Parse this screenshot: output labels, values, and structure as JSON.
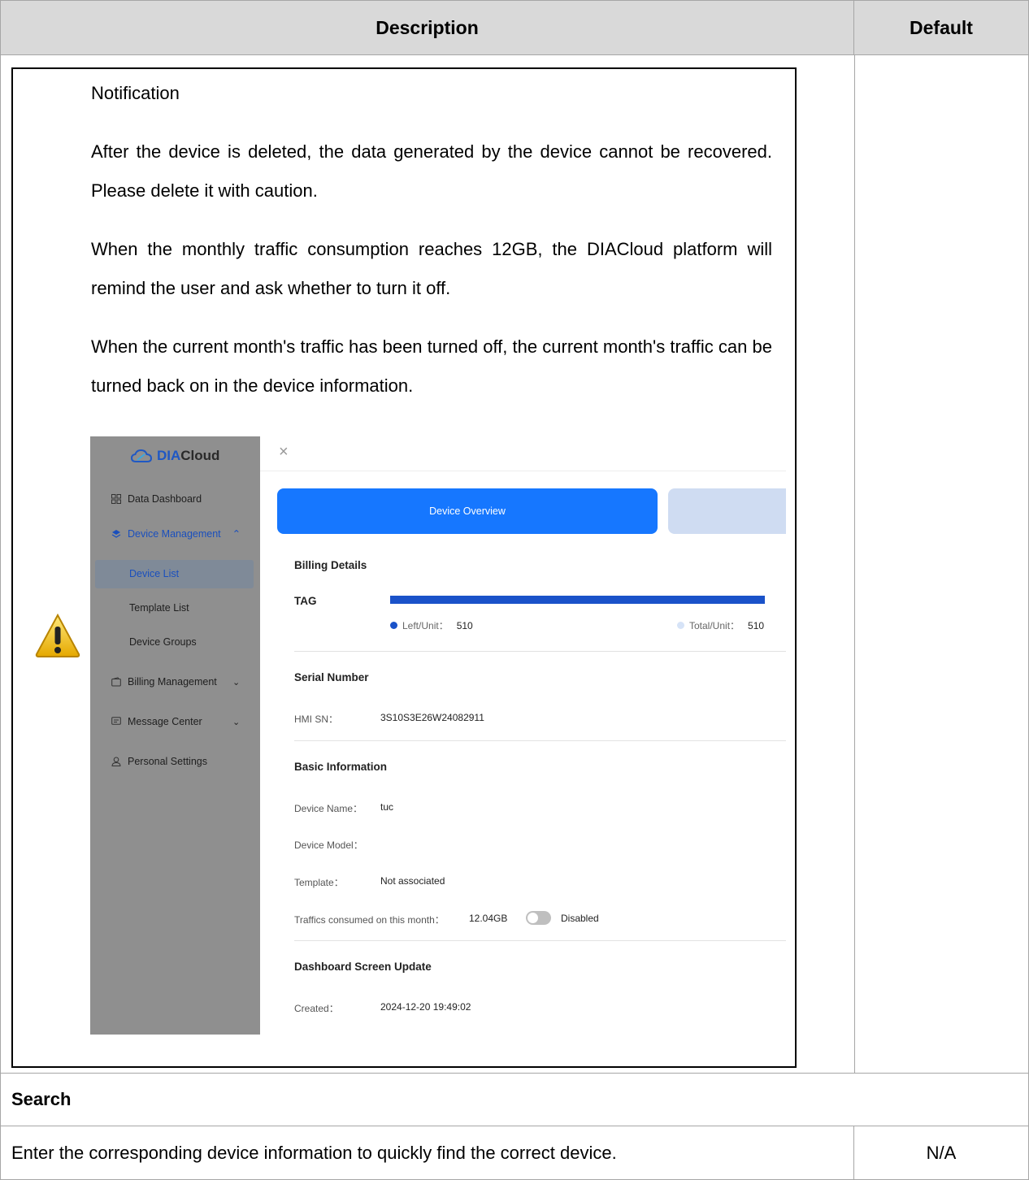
{
  "header": {
    "description": "Description",
    "default": "Default"
  },
  "note": {
    "title": "Notification",
    "paragraphs": [
      "After the device is deleted, the data generated by the device cannot be recovered. Please delete it with caution.",
      "When the monthly traffic consumption reaches 12GB, the DIACloud platform will remind the user and ask whether to turn it off.",
      "When the current month's traffic has been turned off, the current month's traffic can be turned back on in the device information."
    ]
  },
  "screenshot": {
    "logo_dia": "DIA",
    "logo_cloud": "Cloud",
    "sidebar": {
      "data_dashboard": "Data Dashboard",
      "device_management": "Device Management",
      "device_list": "Device List",
      "template_list": "Template List",
      "device_groups": "Device Groups",
      "billing_management": "Billing Management",
      "message_center": "Message Center",
      "personal_settings": "Personal Settings"
    },
    "tab_device_overview": "Device Overview",
    "billing": {
      "title": "Billing Details",
      "tag_label": "TAG",
      "left_label": "Left/Unit：",
      "left_value": "510",
      "total_label": "Total/Unit：",
      "total_value": "510",
      "used_fraction": 1.0
    },
    "serial": {
      "title": "Serial Number",
      "hmi_label": "HMI SN：",
      "hmi_value": "3S10S3E26W24082911"
    },
    "basic": {
      "title": "Basic Information",
      "device_name_label": "Device Name：",
      "device_name_value": "tuc",
      "device_model_label": "Device Model：",
      "template_label": "Template：",
      "template_value": "Not associated",
      "traffic_label": "Traffics consumed on this month：",
      "traffic_value": "12.04GB",
      "traffic_toggle_state": "Disabled"
    },
    "dashboard": {
      "title": "Dashboard Screen Update",
      "created_label": "Created：",
      "created_value": "2024-12-20 19:49:02"
    },
    "colors": {
      "accent": "#1677ff",
      "bar": "#1a52c9",
      "sidebar_bg": "#8f8f8f"
    }
  },
  "search_row": {
    "title": "Search"
  },
  "last_row": {
    "description": "Enter the corresponding device information to quickly find the correct device.",
    "default": "N/A"
  }
}
